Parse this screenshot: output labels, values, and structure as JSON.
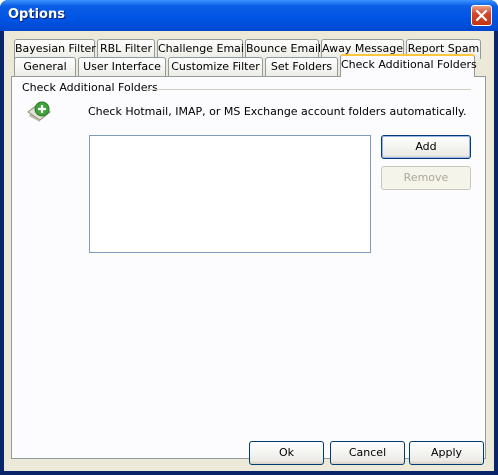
{
  "window": {
    "title": "Options"
  },
  "tabs_row1": [
    "Bayesian Filter",
    "RBL Filter",
    "Challenge Email",
    "Bounce Email",
    "Away Message",
    "Report Spam"
  ],
  "tabs_row2": [
    "General",
    "User Interface",
    "Customize Filter",
    "Set Folders",
    "Check Additional Folders"
  ],
  "active_tab": "Check Additional Folders",
  "group": {
    "title": "Check Additional Folders"
  },
  "description": "Check Hotmail, IMAP, or MS Exchange account folders automatically.",
  "folders_list": {
    "items": []
  },
  "buttons": {
    "add": "Add",
    "remove": "Remove"
  },
  "footer": {
    "ok": "Ok",
    "cancel": "Cancel",
    "apply": "Apply"
  },
  "icons": {
    "folder_add": "folder-add-icon",
    "close": "close-icon"
  },
  "colors": {
    "titlebar": "#0054e3",
    "tab_highlight": "#ffc83c",
    "dialog_bg": "#ece9d8"
  }
}
